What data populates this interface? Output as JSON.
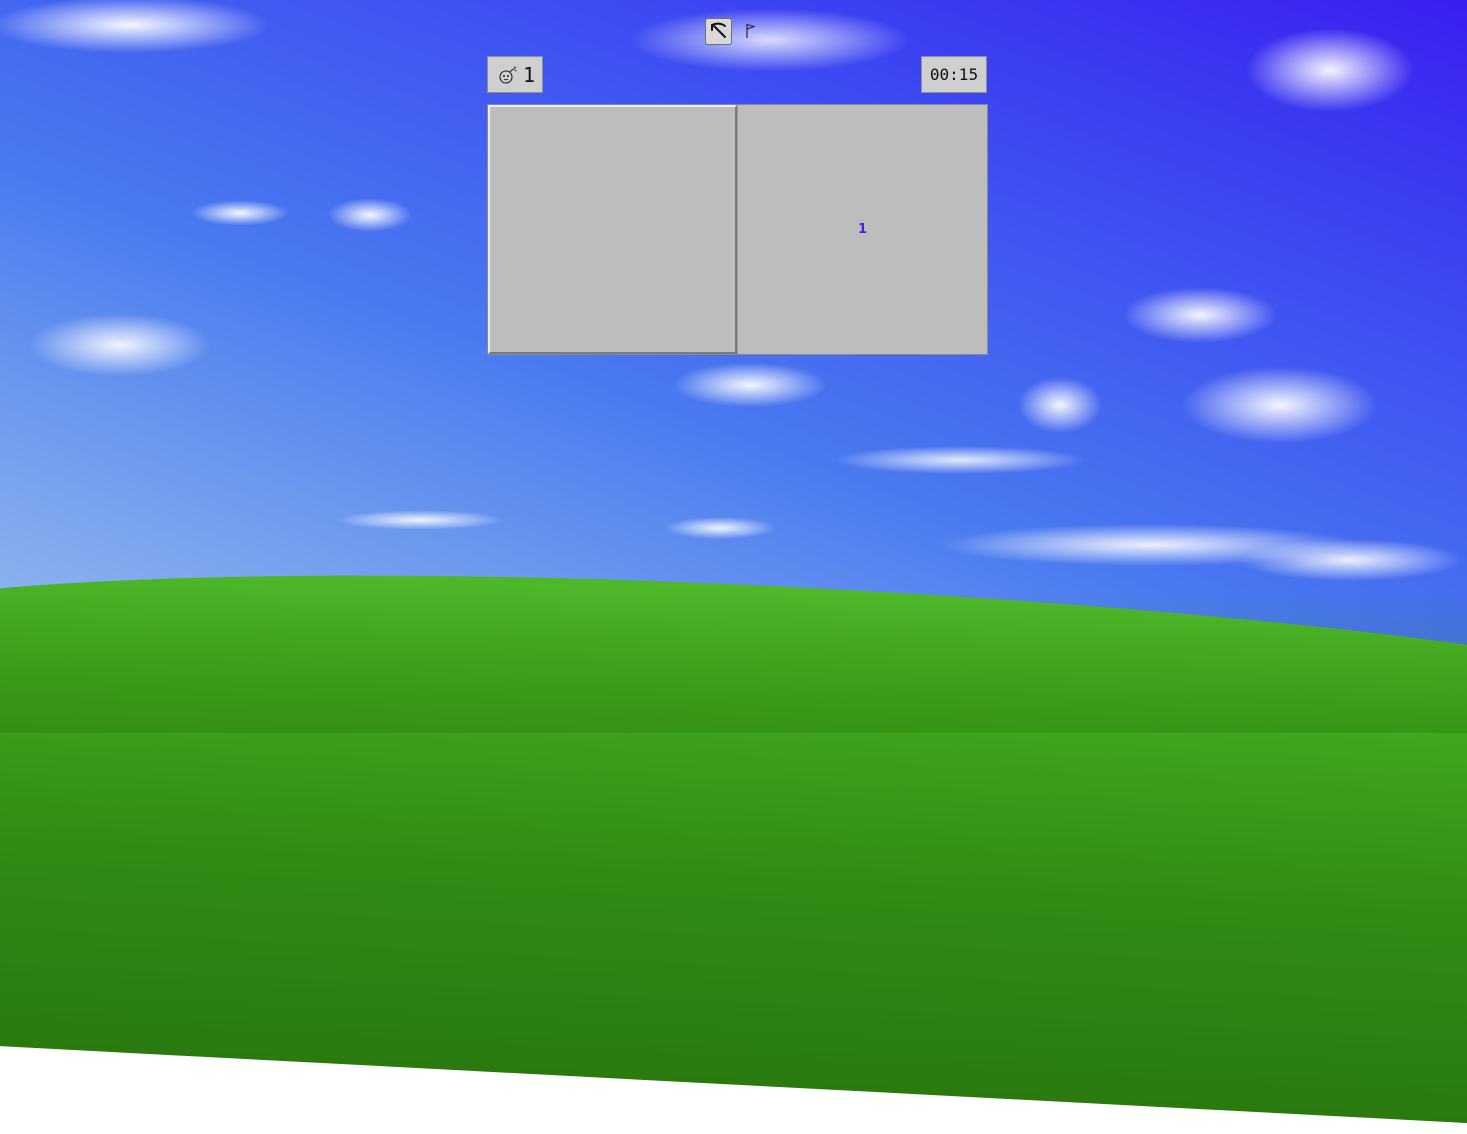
{
  "toolbar": {
    "dig_mode_icon": "pickaxe-icon",
    "flag_mode_icon": "flag-icon",
    "dig_mode_active": true
  },
  "status": {
    "mines_icon": "bomb-icon",
    "mines_remaining": "1",
    "timer": "00:15"
  },
  "board": {
    "rows": 1,
    "cols": 2,
    "cells": [
      {
        "state": "hidden",
        "value": ""
      },
      {
        "state": "revealed",
        "value": "1"
      }
    ],
    "number_color": "#4b1fe0"
  },
  "colors": {
    "cell_gray": "#bdbdbd",
    "panel_gray": "#cfcfcf"
  }
}
